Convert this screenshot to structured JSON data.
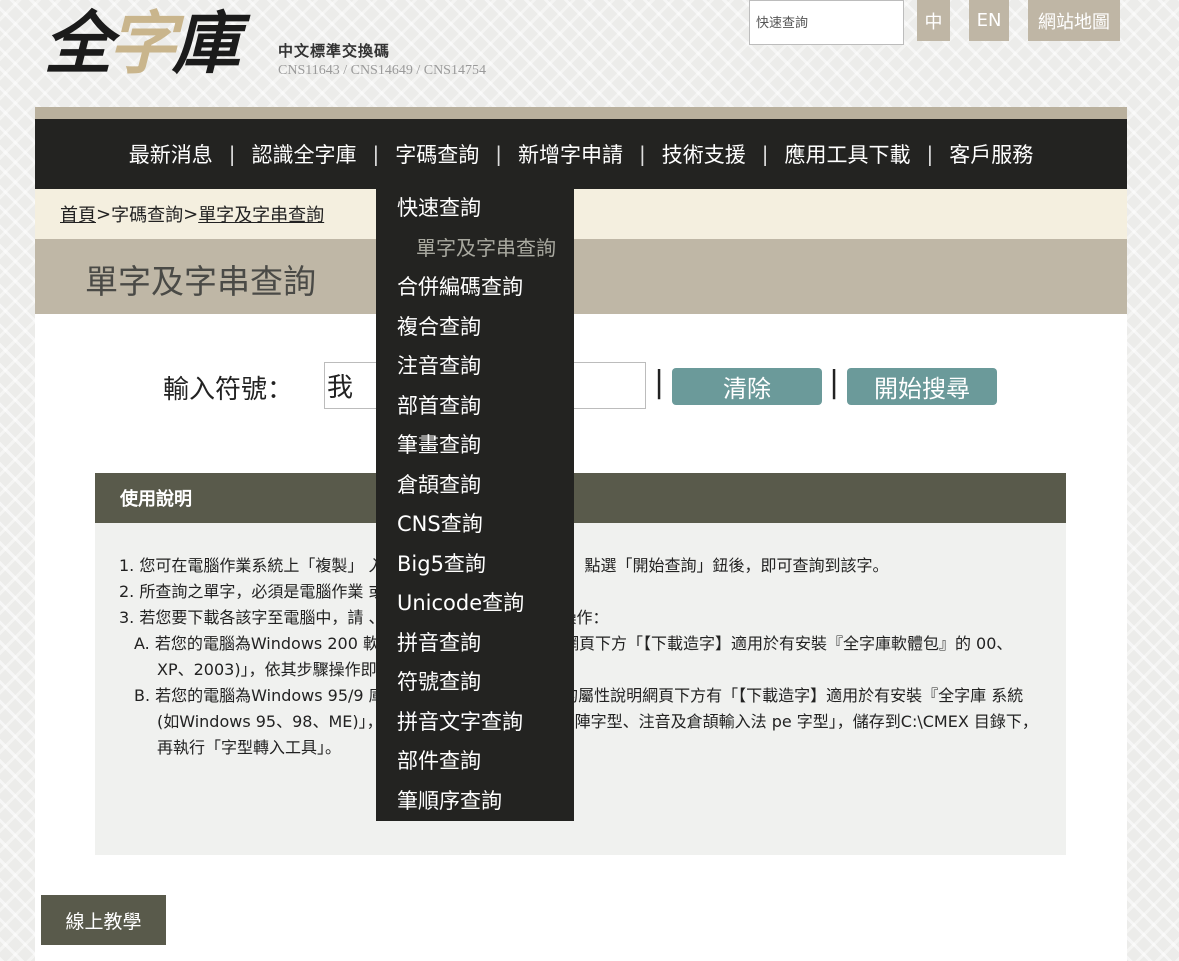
{
  "header": {
    "logo": {
      "glyphs": [
        "全",
        "字",
        "庫"
      ],
      "subtitle": "中文標準交換碼",
      "standards": "CNS11643 / CNS14649 / CNS14754"
    },
    "quick_search_placeholder": "快速查詢",
    "lang_zh": "中",
    "lang_en": "EN",
    "sitemap": "網站地圖"
  },
  "nav": {
    "items": [
      "最新消息",
      "認識全字庫",
      "字碼查詢",
      "新增字申請",
      "技術支援",
      "應用工具下載",
      "客戶服務"
    ],
    "separator": "|"
  },
  "dropdown": {
    "items": [
      {
        "label": "快速查詢",
        "sub": false
      },
      {
        "label": "單字及字串查詢",
        "sub": true
      },
      {
        "label": "合併編碼查詢",
        "sub": false
      },
      {
        "label": "複合查詢",
        "sub": false
      },
      {
        "label": "注音查詢",
        "sub": false
      },
      {
        "label": "部首查詢",
        "sub": false
      },
      {
        "label": "筆畫查詢",
        "sub": false
      },
      {
        "label": "倉頡查詢",
        "sub": false
      },
      {
        "label": "CNS查詢",
        "sub": false
      },
      {
        "label": "Big5查詢",
        "sub": false
      },
      {
        "label": "Unicode查詢",
        "sub": false
      },
      {
        "label": "拼音查詢",
        "sub": false
      },
      {
        "label": "符號查詢",
        "sub": false
      },
      {
        "label": "拼音文字查詢",
        "sub": false
      },
      {
        "label": "部件查詢",
        "sub": false
      },
      {
        "label": "筆順序查詢",
        "sub": false
      }
    ]
  },
  "breadcrumb": {
    "home": "首頁",
    "sep": ">",
    "section": "字碼查詢",
    "current": "單字及字串查詢"
  },
  "page_title": "單字及字串查詢",
  "form": {
    "label": "輸入符號：",
    "value": "我",
    "pipe": "|",
    "clear_button": "清除",
    "search_button": "開始搜尋"
  },
  "instructions": {
    "heading": "使用說明",
    "lines": [
      {
        "kind": "li",
        "text": "1. 您可在電腦作業系統上「複製」                                入」「單字及字串查詢」框內，點選「開始查詢」鈕後，即可查詢到該字。"
      },
      {
        "kind": "li",
        "text": "2. 所查詢之單字，必須是電腦作業                                或使用者自造字無法查詢。"
      },
      {
        "kind": "li",
        "text": "3. 若您要下載各該字至電腦中，請                                、列印該字，請依下列方式操作："
      },
      {
        "kind": "sub",
        "text": "A. 若您的電腦為Windows 200                                軟體包」，在字碼的屬性說明網頁下方「【下載造字】適用於有安裝『全字庫軟體包』的                                00、XP、2003)」，依其步驟操作即可。"
      },
      {
        "kind": "sub",
        "text": "B. 若您的電腦為Windows 95/9                                庫應用工具4.0版」，在字碼的屬性說明網頁下方有「【下載造字】適用於有安裝『全字庫                                系統(如Windows 95、98、ME)」，點選裡面的「下載明體點矩陣字型、注音及倉頡輸入法                                pe 字型」，儲存到C:\\CMEX 目錄下，再執行「字型轉入工具」。"
      }
    ]
  },
  "tutorial_button": "線上教學",
  "colors": {
    "navbar": "#232321",
    "accent_teal": "#6b9a9a",
    "band_tan": "#bfb7a6",
    "breadcrumb_bg": "#f4efdf",
    "instr_head": "#595a4b"
  }
}
